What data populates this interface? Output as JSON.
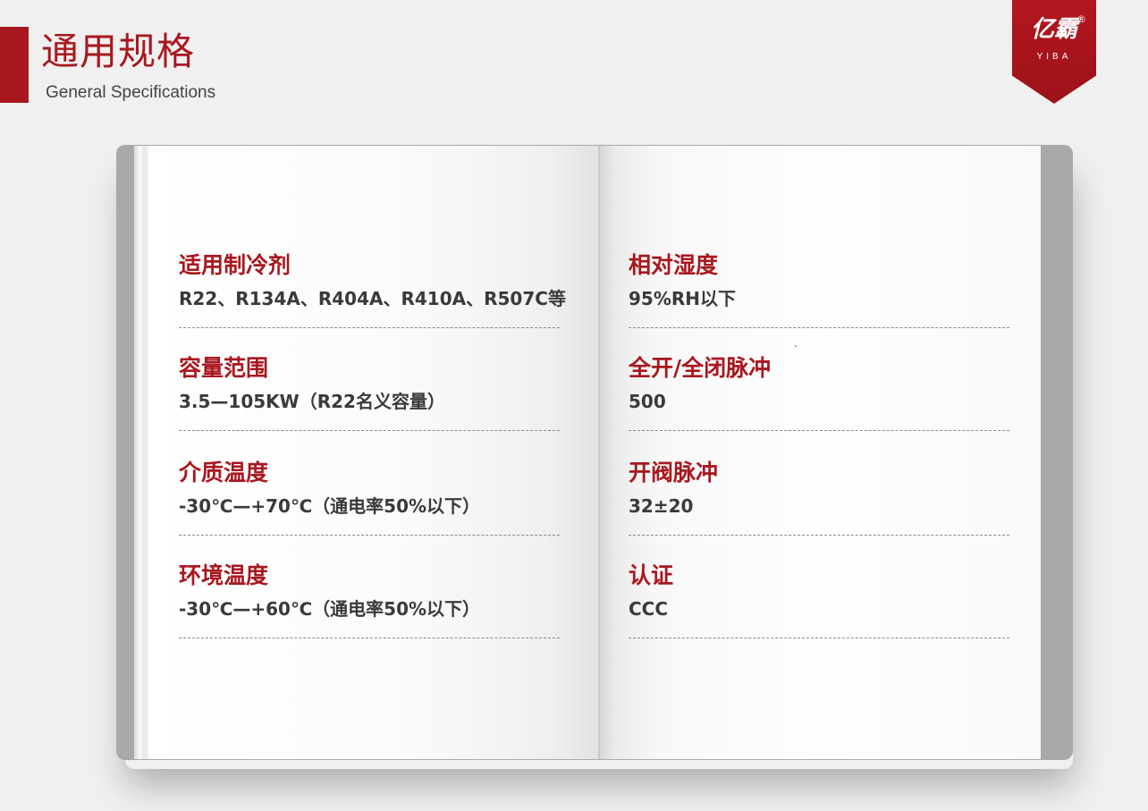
{
  "header": {
    "title": "通用规格",
    "subtitle": "General Specifications"
  },
  "logo": {
    "text_cn": "亿霸",
    "text_en": "YIBA",
    "registered": "®",
    "color": "#a8181f"
  },
  "specs_left": [
    {
      "label": "适用制冷剂",
      "value": "R22、R134A、R404A、R410A、R507C等"
    },
    {
      "label": "容量范围",
      "value": "3.5—105KW（R22名义容量）"
    },
    {
      "label": "介质温度",
      "value": "-30℃—+70℃（通电率50%以下）"
    },
    {
      "label": "环境温度",
      "value": "-30℃—+60℃（通电率50%以下）"
    }
  ],
  "specs_right": [
    {
      "label": "相对湿度",
      "value": "95%RH以下"
    },
    {
      "label": "全开/全闭脉冲",
      "value": "500"
    },
    {
      "label": "开阀脉冲",
      "value": "32±20"
    },
    {
      "label": "认证",
      "value": "CCC"
    }
  ],
  "colors": {
    "accent": "#a8181f",
    "text": "#3a3a3a",
    "background": "#f0f0f0"
  }
}
